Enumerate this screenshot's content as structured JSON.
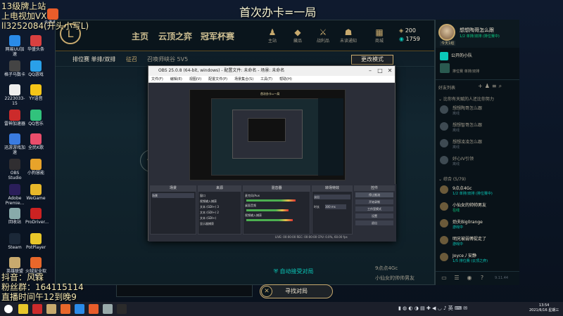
{
  "stream": {
    "title": "首次办卡=一局",
    "top_left": [
      "13级牌上站",
      "上电视加VX",
      "ll3252084(开头小写L)"
    ],
    "bottom_left": [
      "抖音：风霖",
      "粉丝群：164115114",
      "直播时间午12到晚9"
    ]
  },
  "desktop_icons": [
    {
      "label": "头条直播",
      "color": "#e85d2a"
    },
    {
      "label": "网易UU加速",
      "color": "#2a8be8"
    },
    {
      "label": "华盛头条",
      "color": "#d94040"
    },
    {
      "label": "格子马数卡",
      "color": "#444"
    },
    {
      "label": "QQ游戏",
      "color": "#2aa0e8"
    },
    {
      "label": "2223033-15",
      "color": "#eee"
    },
    {
      "label": "YY语音",
      "color": "#f5c518"
    },
    {
      "label": "雷神加速器",
      "color": "#cc2b2b"
    },
    {
      "label": "QQ音乐",
      "color": "#31c27c"
    },
    {
      "label": "迅游游戏加速",
      "color": "#3a7be0"
    },
    {
      "label": "全民K歌",
      "color": "#e94d6b"
    },
    {
      "label": "OBS Studio",
      "color": "#302e31"
    },
    {
      "label": "小狗慧能",
      "color": "#e8a32a"
    },
    {
      "label": "Adobe Premie...",
      "color": "#2a1e5a"
    },
    {
      "label": "WeGame",
      "color": "#e8b82a"
    },
    {
      "label": "回收站",
      "color": "#8aa"
    },
    {
      "label": "ProDriver...",
      "color": "#c22"
    },
    {
      "label": "Steam",
      "color": "#1b2838"
    },
    {
      "label": "PotPlayer",
      "color": "#e8c72a"
    },
    {
      "label": "英雄联盟",
      "color": "#c8aa6e"
    },
    {
      "label": "火绒安全软件",
      "color": "#e8672a"
    }
  ],
  "lol": {
    "logo": "L",
    "nav": [
      "主页",
      "云顶之弈",
      "冠军杯赛"
    ],
    "top_icons": [
      {
        "glyph": "♟",
        "label": "主站"
      },
      {
        "glyph": "◆",
        "label": "藏品"
      },
      {
        "glyph": "⚔",
        "label": "战利品"
      },
      {
        "glyph": "☗",
        "label": "未读通知"
      },
      {
        "glyph": "▦",
        "label": "商城"
      }
    ],
    "currency": {
      "be": "200",
      "rp": "1759"
    },
    "sub": [
      "排位赛 单排/双排",
      "征召",
      "召唤师峡谷 5V5"
    ],
    "more_mode": "更改模式",
    "auto_accept": "自动接受对局",
    "find_match": "寻找对局",
    "party": [
      "9点点4Gc",
      "小仙女的帅帅男友"
    ]
  },
  "obs": {
    "title": "OBS 25.0.8 (64-bit, windows) - 配置文件: 未命名 - 场景: 未命名",
    "menu": [
      "文件(F)",
      "编辑(E)",
      "视图(V)",
      "配置文件(P)",
      "场景集合(S)",
      "工具(T)",
      "帮助(H)"
    ],
    "docks": [
      "场景",
      "来源",
      "混音器",
      "转场特效",
      "控件"
    ],
    "scene": "场景",
    "sources": [
      "窗口",
      "视频输入捕获",
      "文本 (GDI+) 3",
      "文本 (GDI+) 2",
      "文本 (GDI+)",
      "显示器捕获"
    ],
    "mixer": [
      "麦克风/Aux",
      "桌面音频",
      "视频输入捕获"
    ],
    "transition": "淡出",
    "duration_label": "时长",
    "duration": "300 ms",
    "controls": [
      "停止推流",
      "开始录制",
      "工作室模式",
      "设置",
      "退出"
    ],
    "status": "LIVE: 00:00:00   REC: 00:00:00   CPU: 0.0%, 60.00 fps"
  },
  "friends": {
    "name": "想想陶哥怎么跟",
    "status": "1/2 单排/双排 (排位赛中)",
    "badge": "今天1组",
    "social_label": "公开的小队",
    "social_sub": "排位赛 单排/双排",
    "header": "好友列表",
    "group1": "比你有天赋的人还比你努力",
    "group2": "综合 (5/79)",
    "list": [
      {
        "name": "想想陶哥怎么跟",
        "status": "离线",
        "state": "off"
      },
      {
        "name": "想想智哥怎么跟",
        "status": "离线",
        "state": "off"
      },
      {
        "name": "想想凌凌怎么跟",
        "status": "离线",
        "state": "off"
      },
      {
        "name": "好心IV引领",
        "status": "离线",
        "state": "off"
      },
      {
        "name": "9点点4Gc",
        "status": "1/2 单排/双排 (排位赛中)",
        "state": "ingame"
      },
      {
        "name": "小仙女的帅帅男友",
        "status": "在线",
        "state": "online"
      },
      {
        "name": "劲夫Big0range",
        "status": "游戏中",
        "state": "ingame"
      },
      {
        "name": "明兄被弱傅捉走了",
        "status": "游戏中",
        "state": "ingame"
      },
      {
        "name": "Joyce丿安静",
        "status": "1/5 排位赛 (云顶之弈)",
        "state": "ingame"
      }
    ],
    "version": "9.11.44"
  },
  "taskbar": {
    "clock_time": "13:54",
    "clock_date": "2021/6/16 星期三",
    "icons": [
      "#e8c72a",
      "#cc2b2b",
      "#c8aa6e",
      "#e8672a",
      "#2a8be8",
      "#e85d2a",
      "#9aa",
      "#2b2b2b"
    ]
  }
}
